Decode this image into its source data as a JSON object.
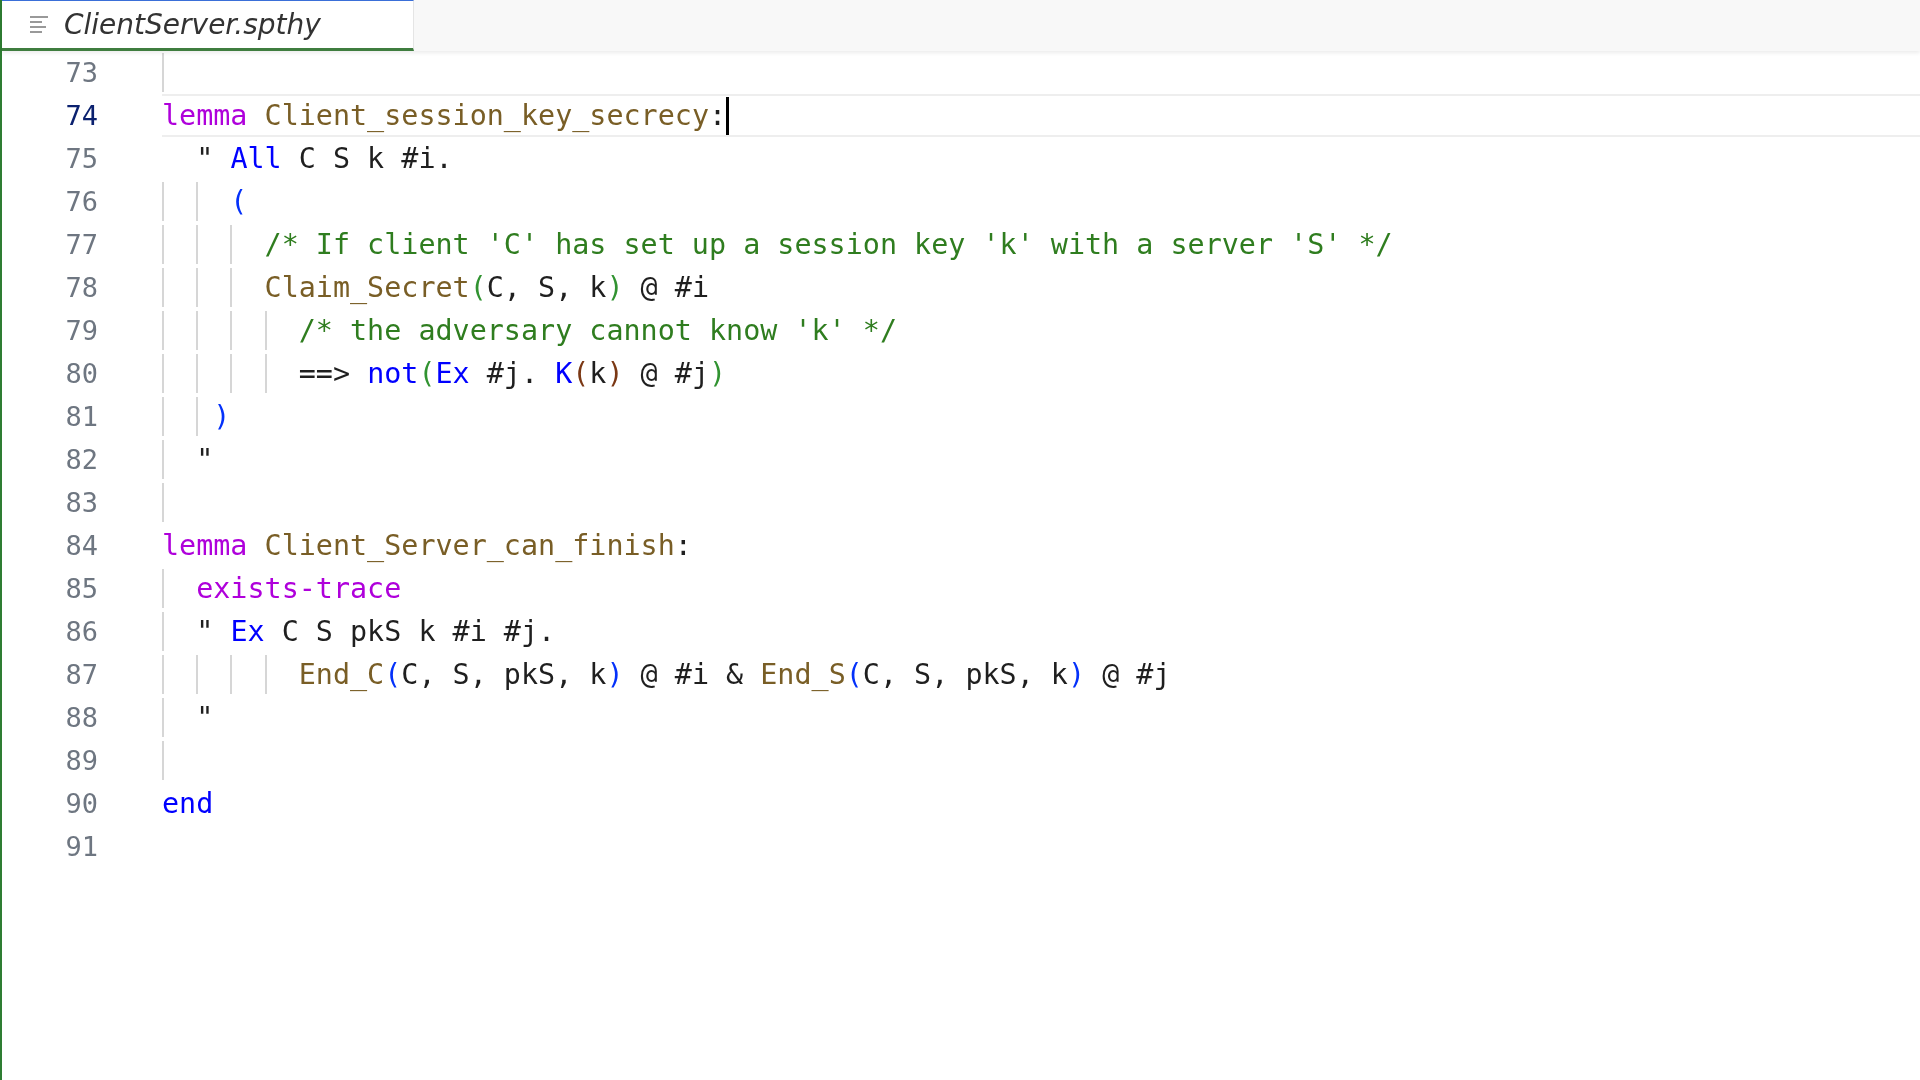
{
  "tabs": [
    {
      "title": "ClientServer.spthy",
      "selected": true,
      "preview": true
    }
  ],
  "editor": {
    "lines": [
      {
        "number": "73",
        "current": false,
        "guides": [
          {
            "kind": "indent"
          }
        ]
      },
      {
        "number": "74",
        "current": true,
        "tokens": [
          {
            "kind": "keyword",
            "text": "lemma"
          },
          {
            "kind": "name",
            "text": " Client_session_key_secrecy"
          },
          {
            "kind": "plain",
            "text": ":"
          }
        ]
      },
      {
        "number": "75",
        "current": false,
        "tokens": [
          {
            "kind": "plain",
            "text": "  \" "
          },
          {
            "kind": "quant",
            "text": "All"
          },
          {
            "kind": "plain",
            "text": " C S k #i."
          }
        ]
      },
      {
        "number": "76",
        "current": false,
        "guides": [
          {
            "kind": "indent"
          },
          {
            "kind": "indent"
          }
        ],
        "tokens": [
          {
            "kind": "bracket1",
            "text": "    ("
          }
        ]
      },
      {
        "number": "77",
        "current": false,
        "guides": [
          {
            "kind": "indent"
          },
          {
            "kind": "indent"
          },
          {
            "kind": "indent"
          }
        ],
        "tokens": [
          {
            "kind": "comment",
            "text": "      /* If client 'C' has set up a session key 'k' with a server 'S' */"
          }
        ]
      },
      {
        "number": "78",
        "current": false,
        "guides": [
          {
            "kind": "indent"
          },
          {
            "kind": "indent"
          },
          {
            "kind": "indent"
          }
        ],
        "tokens": [
          {
            "kind": "name",
            "text": "      Claim_Secret"
          },
          {
            "kind": "bracket2",
            "text": "("
          },
          {
            "kind": "plain",
            "text": "C, S, k"
          },
          {
            "kind": "bracket2",
            "text": ")"
          },
          {
            "kind": "plain",
            "text": " @ #i"
          }
        ]
      },
      {
        "number": "79",
        "current": false,
        "guides": [
          {
            "kind": "indent"
          },
          {
            "kind": "indent"
          },
          {
            "kind": "indent"
          },
          {
            "kind": "indent"
          }
        ],
        "tokens": [
          {
            "kind": "comment",
            "text": "        /* the adversary cannot know 'k' */"
          }
        ]
      },
      {
        "number": "80",
        "current": false,
        "guides": [
          {
            "kind": "indent"
          },
          {
            "kind": "indent"
          },
          {
            "kind": "indent"
          },
          {
            "kind": "indent"
          }
        ],
        "tokens": [
          {
            "kind": "plain",
            "text": "        ==> "
          },
          {
            "kind": "quant",
            "text": "not"
          },
          {
            "kind": "bracket2",
            "text": "("
          },
          {
            "kind": "quant",
            "text": "Ex"
          },
          {
            "kind": "plain",
            "text": " #j. "
          },
          {
            "kind": "quant",
            "text": "K"
          },
          {
            "kind": "bracket3",
            "text": "("
          },
          {
            "kind": "plain",
            "text": "k"
          },
          {
            "kind": "bracket3",
            "text": ")"
          },
          {
            "kind": "plain",
            "text": " @ #j"
          },
          {
            "kind": "bracket2",
            "text": ")"
          }
        ]
      },
      {
        "number": "81",
        "current": false,
        "guides": [
          {
            "kind": "indent"
          },
          {
            "kind": "indent"
          }
        ],
        "tokens": [
          {
            "kind": "bracket1",
            "text": "   )"
          }
        ]
      },
      {
        "number": "82",
        "current": false,
        "guides": [
          {
            "kind": "indent"
          }
        ],
        "tokens": [
          {
            "kind": "plain",
            "text": "  \""
          }
        ]
      },
      {
        "number": "83",
        "current": false,
        "guides": [
          {
            "kind": "indent"
          }
        ]
      },
      {
        "number": "84",
        "current": false,
        "tokens": [
          {
            "kind": "keyword",
            "text": "lemma"
          },
          {
            "kind": "name",
            "text": " Client_Server_can_finish"
          },
          {
            "kind": "plain",
            "text": ":"
          }
        ]
      },
      {
        "number": "85",
        "current": false,
        "guides": [
          {
            "kind": "indent"
          }
        ],
        "tokens": [
          {
            "kind": "keyword",
            "text": "  exists-trace"
          }
        ]
      },
      {
        "number": "86",
        "current": false,
        "guides": [
          {
            "kind": "indent"
          }
        ],
        "tokens": [
          {
            "kind": "plain",
            "text": "  \" "
          },
          {
            "kind": "quant",
            "text": "Ex"
          },
          {
            "kind": "plain",
            "text": " C S pkS k #i #j."
          }
        ]
      },
      {
        "number": "87",
        "current": false,
        "guides": [
          {
            "kind": "indent"
          },
          {
            "kind": "indent"
          },
          {
            "kind": "indent"
          },
          {
            "kind": "indent"
          }
        ],
        "tokens": [
          {
            "kind": "name",
            "text": "        End_C"
          },
          {
            "kind": "bracket1",
            "text": "("
          },
          {
            "kind": "plain",
            "text": "C, S, pkS, k"
          },
          {
            "kind": "bracket1",
            "text": ")"
          },
          {
            "kind": "plain",
            "text": " @ #i & "
          },
          {
            "kind": "name",
            "text": "End_S"
          },
          {
            "kind": "bracket1",
            "text": "("
          },
          {
            "kind": "plain",
            "text": "C, S, pkS, k"
          },
          {
            "kind": "bracket1",
            "text": ")"
          },
          {
            "kind": "plain",
            "text": " @ #j"
          }
        ]
      },
      {
        "number": "88",
        "current": false,
        "guides": [
          {
            "kind": "indent"
          }
        ],
        "tokens": [
          {
            "kind": "plain",
            "text": "  \""
          }
        ]
      },
      {
        "number": "89",
        "current": false,
        "guides": [
          {
            "kind": "indent"
          }
        ]
      },
      {
        "number": "90",
        "current": false,
        "tokens": [
          {
            "kind": "quant",
            "text": "end"
          }
        ]
      },
      {
        "number": "91",
        "current": false
      }
    ]
  }
}
